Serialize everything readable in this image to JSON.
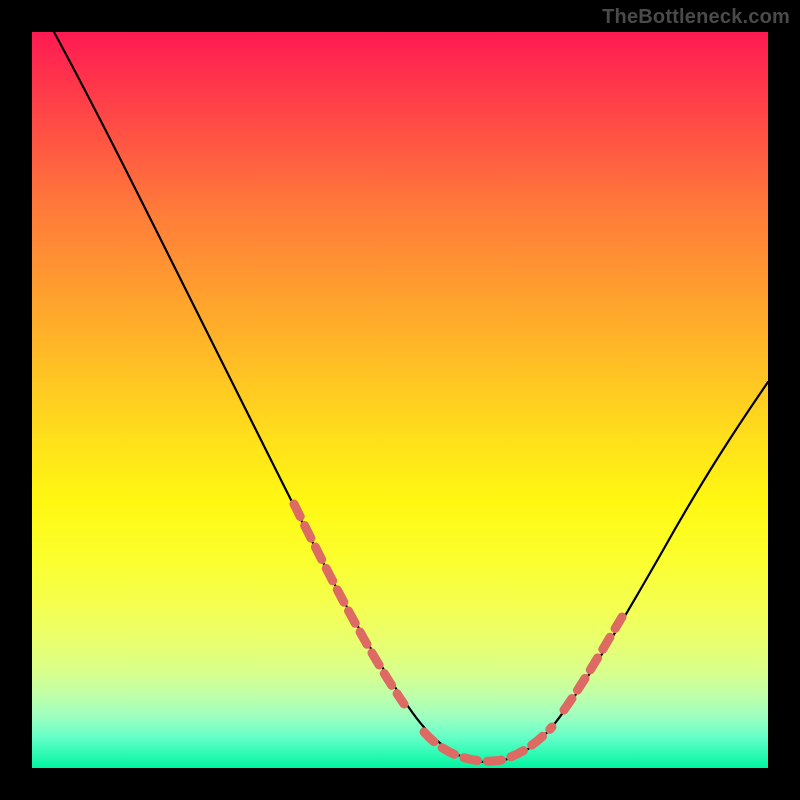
{
  "watermark": "TheBottleneck.com",
  "colors": {
    "frame_bg": "#000000",
    "gradient_top": "#ff1a52",
    "gradient_bottom": "#00f5a0",
    "curve": "#000000",
    "markers": "#dd6b63"
  },
  "chart_data": {
    "type": "line",
    "title": "",
    "xlabel": "",
    "ylabel": "",
    "xlim": [
      0,
      100
    ],
    "ylim": [
      0,
      100
    ],
    "grid": false,
    "legend": false,
    "series": [
      {
        "name": "bottleneck-curve",
        "x": [
          3,
          10,
          18,
          25,
          32,
          38,
          44,
          50,
          54,
          58,
          62,
          66,
          70,
          75,
          80,
          86,
          92,
          100
        ],
        "y": [
          100,
          87,
          73,
          60,
          47,
          35,
          24,
          14,
          8,
          3,
          1,
          1,
          3,
          8,
          16,
          26,
          37,
          52
        ]
      }
    ],
    "highlight_ranges": [
      {
        "name": "left-descent-markers",
        "x_start": 34,
        "x_end": 50
      },
      {
        "name": "valley-markers",
        "x_start": 54,
        "x_end": 68
      },
      {
        "name": "right-ascent-markers",
        "x_start": 70,
        "x_end": 78
      }
    ],
    "annotations": []
  }
}
